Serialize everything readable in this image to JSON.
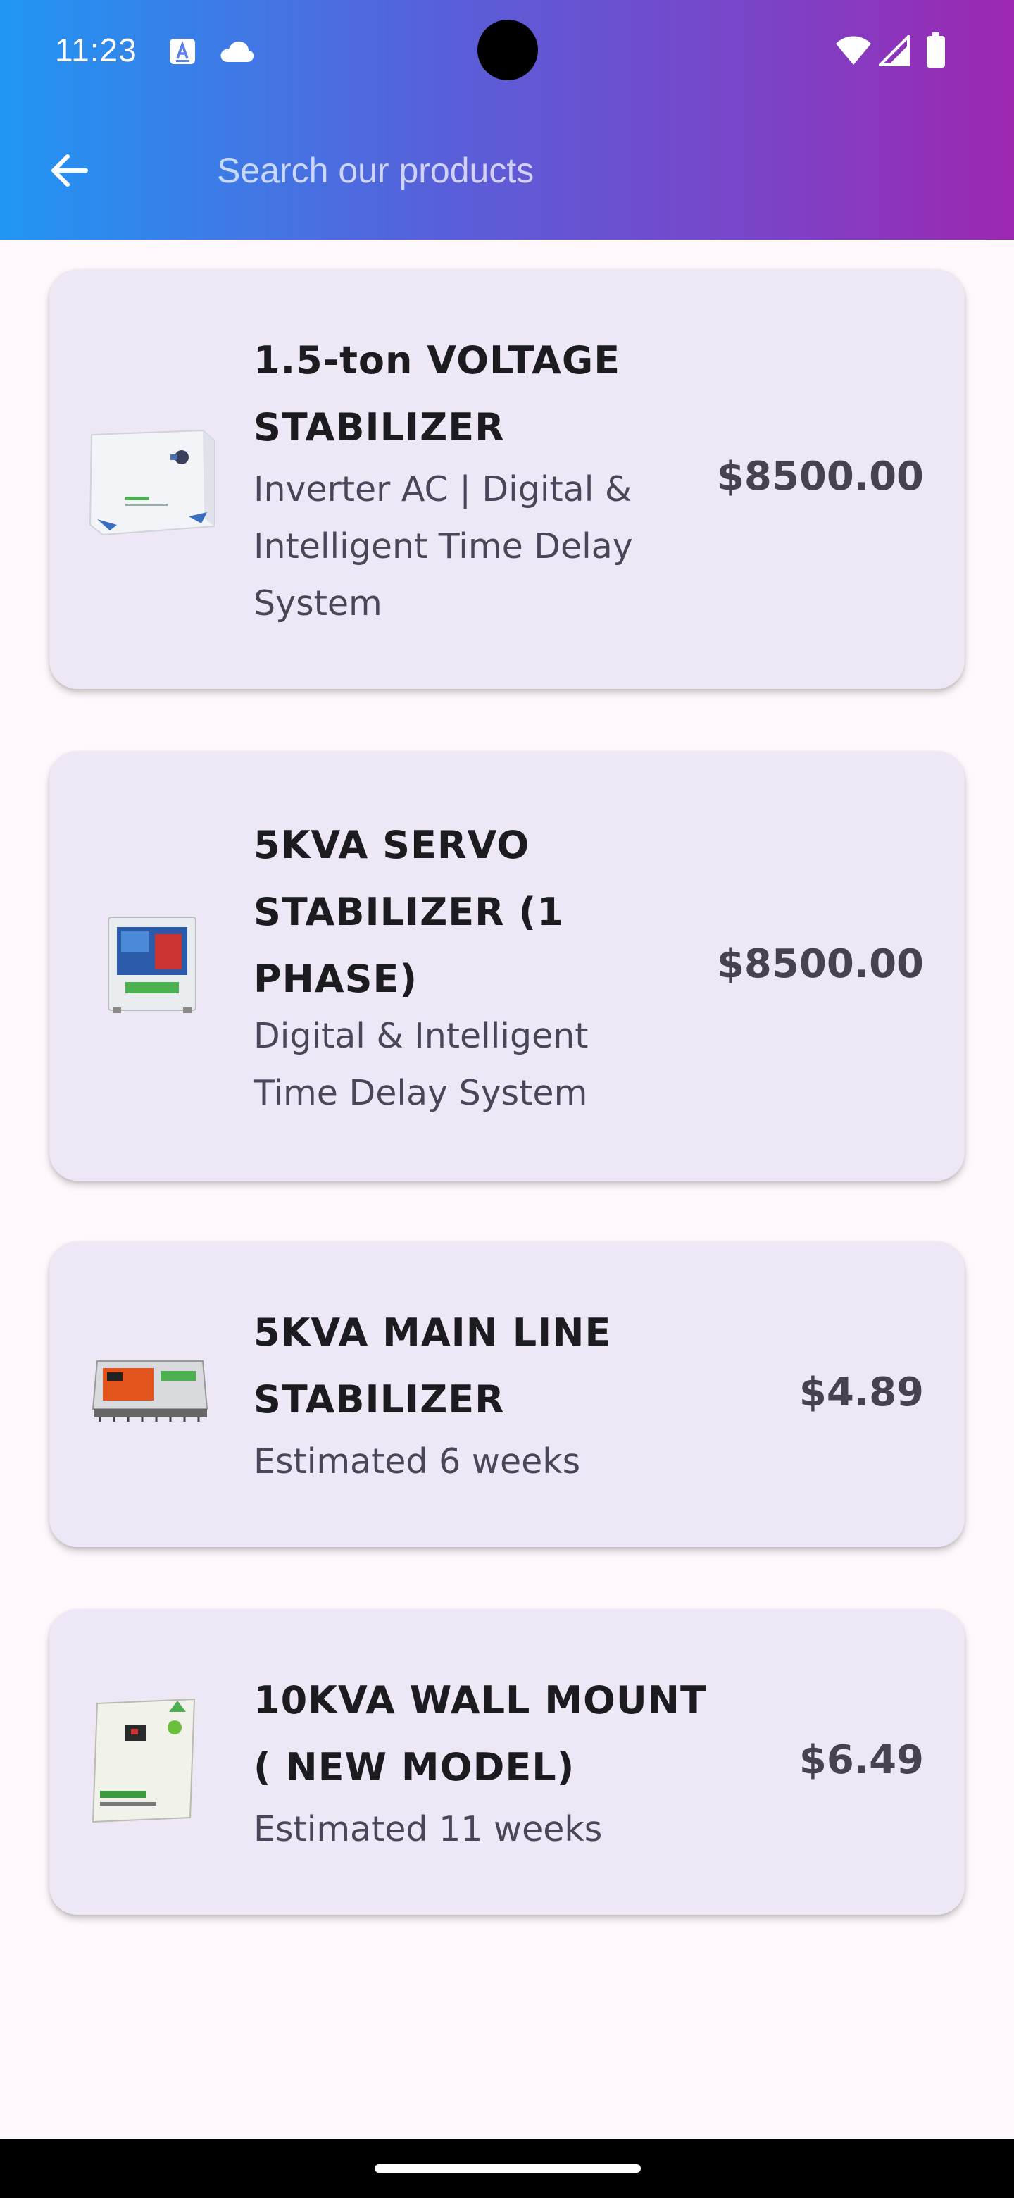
{
  "status_bar": {
    "time": "11:23",
    "icons": [
      "a-notification-icon",
      "cloud-icon",
      "wifi-icon",
      "signal-icon",
      "battery-icon"
    ]
  },
  "toolbar": {
    "back_icon": "arrow-left-icon",
    "search_placeholder": "Search our products",
    "search_value": ""
  },
  "products": [
    {
      "title_lines": [
        "1.5-ton VOLTAGE",
        "STABILIZER"
      ],
      "subtitle_lines": [
        "Inverter AC | Digital &",
        "Intelligent Time Delay",
        "System"
      ],
      "price": "$8500.00",
      "image": "white-voltage-stabilizer-image"
    },
    {
      "title_lines": [
        "5KVA SERVO",
        "STABILIZER (1",
        "PHASE)"
      ],
      "subtitle_lines": [
        "Digital & Intelligent",
        "Time Delay System"
      ],
      "price": "$8500.00",
      "image": "servo-stabilizer-image"
    },
    {
      "title_lines": [
        "5KVA MAIN LINE",
        "STABILIZER"
      ],
      "subtitle_lines": [
        "Estimated 6 weeks"
      ],
      "price": "$4.89",
      "image": "main-line-stabilizer-image"
    },
    {
      "title_lines": [
        "10KVA WALL MOUNT",
        "( NEW MODEL)"
      ],
      "subtitle_lines": [
        "Estimated 11 weeks"
      ],
      "price": "$6.49",
      "image": "wall-mount-stabilizer-image"
    }
  ],
  "colors": {
    "appbar_gradient_start": "#2196f3",
    "appbar_gradient_end": "#9c27b0",
    "card_background": "#eee7f6",
    "page_background": "#fef8fd"
  }
}
